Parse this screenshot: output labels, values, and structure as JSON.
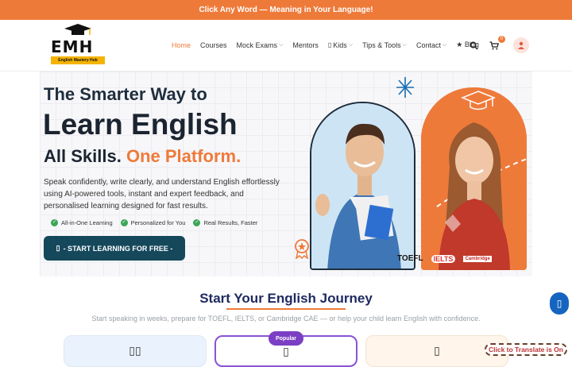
{
  "topbar": {
    "text": "Click Any Word — Meaning in Your Language!"
  },
  "logo": {
    "letters": "EMH",
    "tagline": "English Mastery Hub"
  },
  "nav": {
    "items": [
      {
        "label": "Home",
        "dropdown": false,
        "active": true
      },
      {
        "label": "Courses",
        "dropdown": false,
        "active": false
      },
      {
        "label": "Mock Exams",
        "dropdown": true,
        "active": false
      },
      {
        "label": "Mentors",
        "dropdown": false,
        "active": false
      },
      {
        "label": "Kids",
        "dropdown": true,
        "active": false
      },
      {
        "label": "Tips & Tools",
        "dropdown": true,
        "active": false
      },
      {
        "label": "Contact",
        "dropdown": true,
        "active": false
      },
      {
        "label": "★ Blog",
        "dropdown": false,
        "active": false
      }
    ],
    "cart_count": "0"
  },
  "hero": {
    "line1": "The Smarter Way to",
    "line2": "Learn English",
    "line3_a": "All Skills.",
    "line3_b": "One Platform.",
    "description": "Speak confidently, write clearly, and understand English effortlessly using AI-powered tools, instant and expert feedback, and personalised learning designed for fast results.",
    "checks": [
      "All-in-One Learning",
      "Personalized for You",
      "Real Results, Faster"
    ],
    "cta": "- START LEARNING FOR FREE -",
    "exam_logos": [
      "TOEFL",
      "IELTS",
      "Cambridge"
    ]
  },
  "section": {
    "title": "Start Your English Journey",
    "subtitle": "Start speaking in weeks, prepare for TOEFL, IELTS, or Cambridge CAE — or help your child learn English with confidence.",
    "popular_badge": "Popular"
  },
  "translate_pill": "Click to Translate is On",
  "colors": {
    "accent": "#ee7a3a",
    "navy": "#16485c",
    "purple": "#7b3fc4"
  }
}
